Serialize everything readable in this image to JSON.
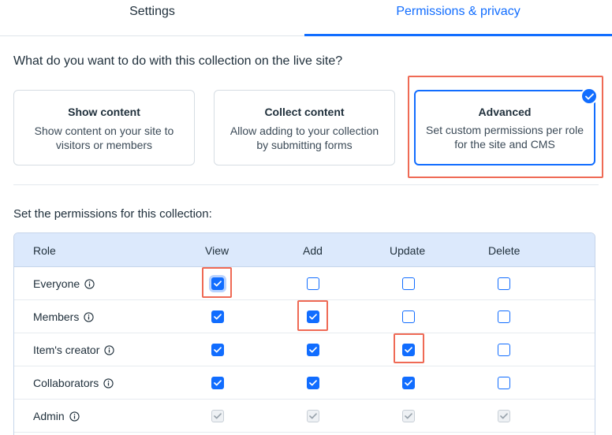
{
  "tabs": [
    {
      "label": "Settings",
      "active": false
    },
    {
      "label": "Permissions & privacy",
      "active": true
    }
  ],
  "question": "What do you want to do with this collection on the live site?",
  "options": [
    {
      "title": "Show content",
      "desc": "Show content on your site to visitors or members",
      "selected": false
    },
    {
      "title": "Collect content",
      "desc": "Allow adding to your collection by submitting forms",
      "selected": false
    },
    {
      "title": "Advanced",
      "desc": "Set custom permissions per role for the site and CMS",
      "selected": true
    }
  ],
  "permissions_title": "Set the permissions for this collection:",
  "table": {
    "columns": [
      "Role",
      "View",
      "Add",
      "Update",
      "Delete"
    ],
    "rows": [
      {
        "role": "Everyone",
        "view": true,
        "add": false,
        "update": false,
        "delete": false
      },
      {
        "role": "Members",
        "view": true,
        "add": true,
        "update": false,
        "delete": false
      },
      {
        "role": "Item's creator",
        "view": true,
        "add": true,
        "update": true,
        "delete": false
      },
      {
        "role": "Collaborators",
        "view": true,
        "add": true,
        "update": true,
        "delete": false
      },
      {
        "role": "Admin",
        "view": true,
        "add": true,
        "update": true,
        "delete": true,
        "disabled": true
      }
    ]
  },
  "colors": {
    "accent": "#116dff",
    "highlight": "#ef6a55",
    "header_bg": "#dce9fc"
  },
  "icons": {
    "info": "info-circle-icon",
    "check": "checkmark-icon"
  }
}
